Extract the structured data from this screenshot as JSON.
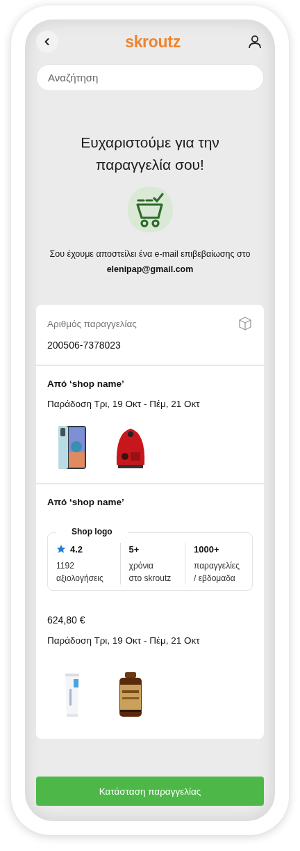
{
  "header": {
    "logo": "skroutz"
  },
  "search": {
    "placeholder": "Αναζήτηση"
  },
  "confirmation": {
    "title": "Ευχαριστούμε για την παραγγελία σου!",
    "message": "Σου έχουμε αποστείλει ένα e-mail επιβεβαίωσης στο **elenipap@gmail.com**"
  },
  "order": {
    "number_label": "Αριθμός παραγγελίας",
    "number": "200506-7378023"
  },
  "shipments": [
    {
      "shop": "Από ‘shop name’",
      "delivery": "Παράδοση Τρι, 19 Οκτ - Πέμ, 21 Οκτ"
    },
    {
      "shop": "Από ‘shop name’",
      "shop_info": {
        "legend": "Shop logo",
        "stats": [
          {
            "value": "4.2",
            "label": "1192\nαξιολογήσεις",
            "kind": "rating"
          },
          {
            "value": "5+",
            "label": "χρόνια\nστο skroutz",
            "kind": "plain"
          },
          {
            "value": "1000+",
            "label": "παραγγελίες\n/ εβδομαδα",
            "kind": "plain"
          }
        ]
      },
      "price": "624,80 €",
      "delivery": "Παράδοση Τρι, 19 Οκτ - Πέμ, 21 Οκτ"
    }
  ],
  "button": {
    "label": "Κατάσταση παραγγελίας"
  }
}
